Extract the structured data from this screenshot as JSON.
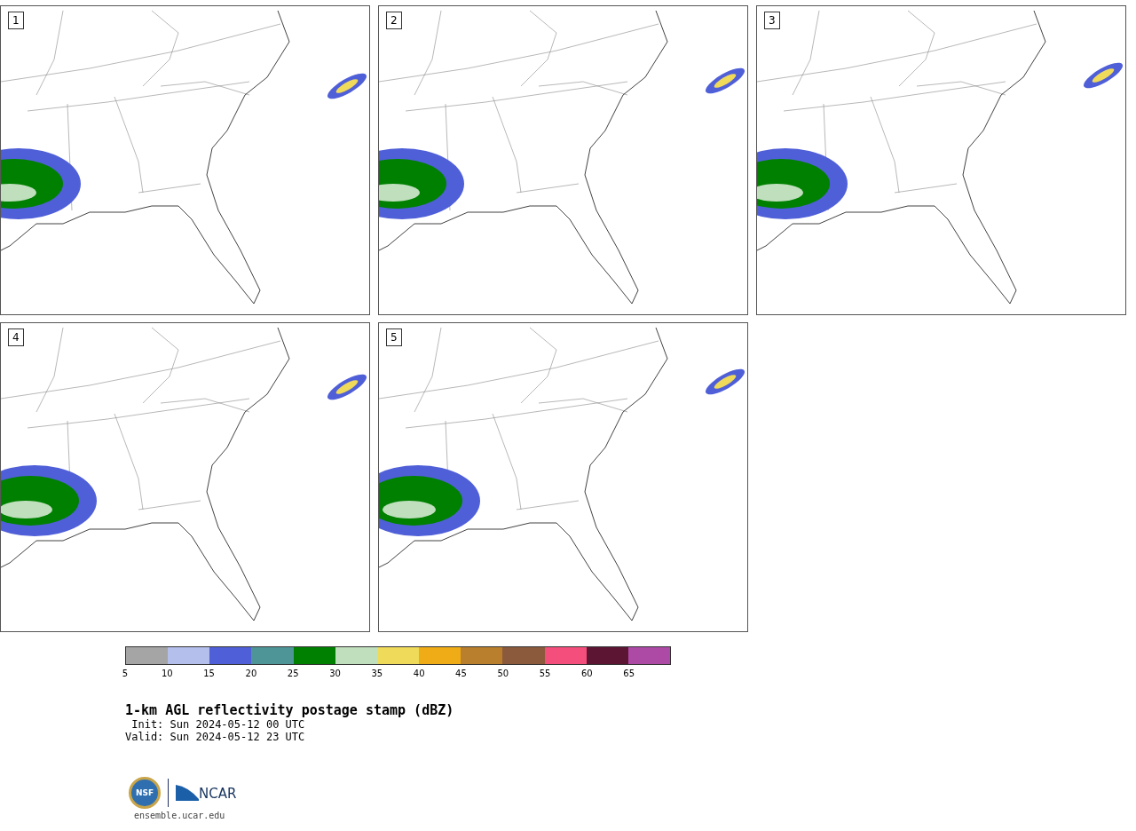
{
  "panels": [
    {
      "label": "1"
    },
    {
      "label": "2"
    },
    {
      "label": "3"
    },
    {
      "label": "4"
    },
    {
      "label": "5"
    }
  ],
  "colorbar": {
    "bins": [
      {
        "color": "#a5a5a5"
      },
      {
        "color": "#b4bfeb"
      },
      {
        "color": "#4f5fd8"
      },
      {
        "color": "#4e9598"
      },
      {
        "color": "#008000"
      },
      {
        "color": "#bfdfbd"
      },
      {
        "color": "#f0da5a"
      },
      {
        "color": "#efac17"
      },
      {
        "color": "#b97f2c"
      },
      {
        "color": "#8b5a3c"
      },
      {
        "color": "#f44f7c"
      },
      {
        "color": "#5c1633"
      },
      {
        "color": "#ad4aa6"
      }
    ],
    "ticks": [
      "5",
      "10",
      "15",
      "20",
      "25",
      "30",
      "35",
      "40",
      "45",
      "50",
      "55",
      "60",
      "65"
    ]
  },
  "title": "1-km AGL reflectivity postage stamp (dBZ)",
  "init": " Init: Sun 2024-05-12 00 UTC",
  "valid": "Valid: Sun 2024-05-12 23 UTC",
  "logos": {
    "nsf": "NSF",
    "ncar": "NCAR"
  },
  "footer_url": "ensemble.ucar.edu"
}
